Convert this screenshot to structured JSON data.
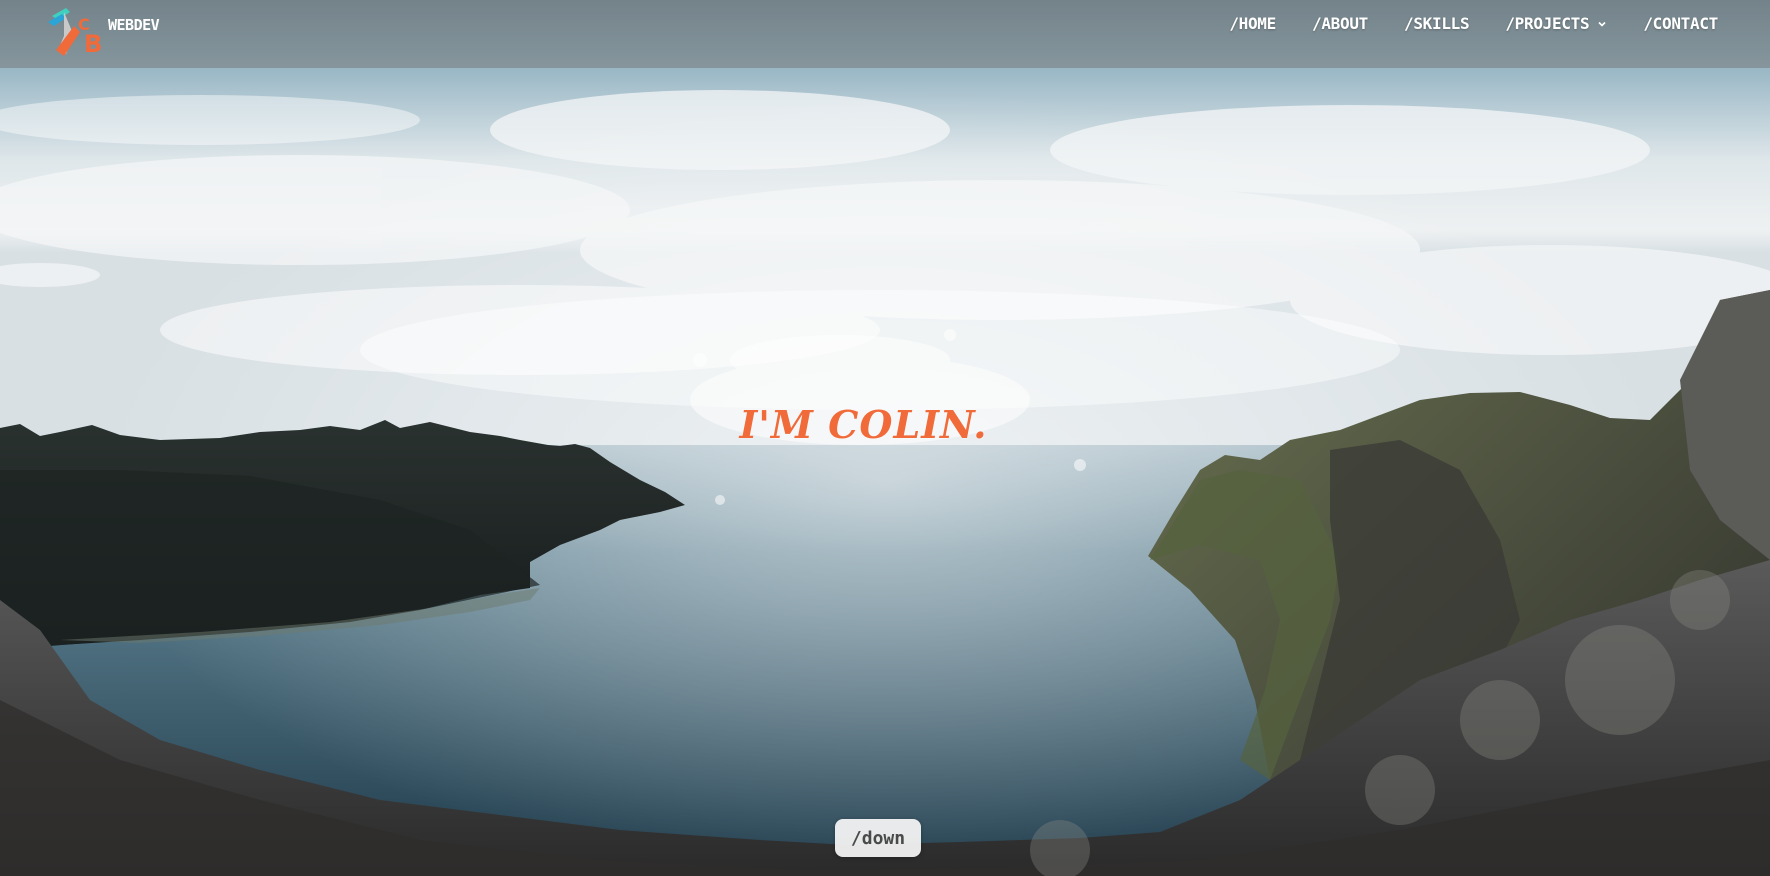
{
  "brand": {
    "logo_letters": "CB",
    "name": "WEBDEV"
  },
  "nav": {
    "items": [
      {
        "label": "/HOME"
      },
      {
        "label": "/ABOUT"
      },
      {
        "label": "/SKILLS"
      },
      {
        "label": "/PROJECTS"
      },
      {
        "label": "/CONTACT"
      }
    ],
    "projects_dropdown_icon": "chevron-down-icon"
  },
  "hero": {
    "title": "I'M COLIN.",
    "accent_color": "#f06a3a",
    "background": "fjord-mountain-landscape"
  },
  "down_button": {
    "label": "/down"
  }
}
